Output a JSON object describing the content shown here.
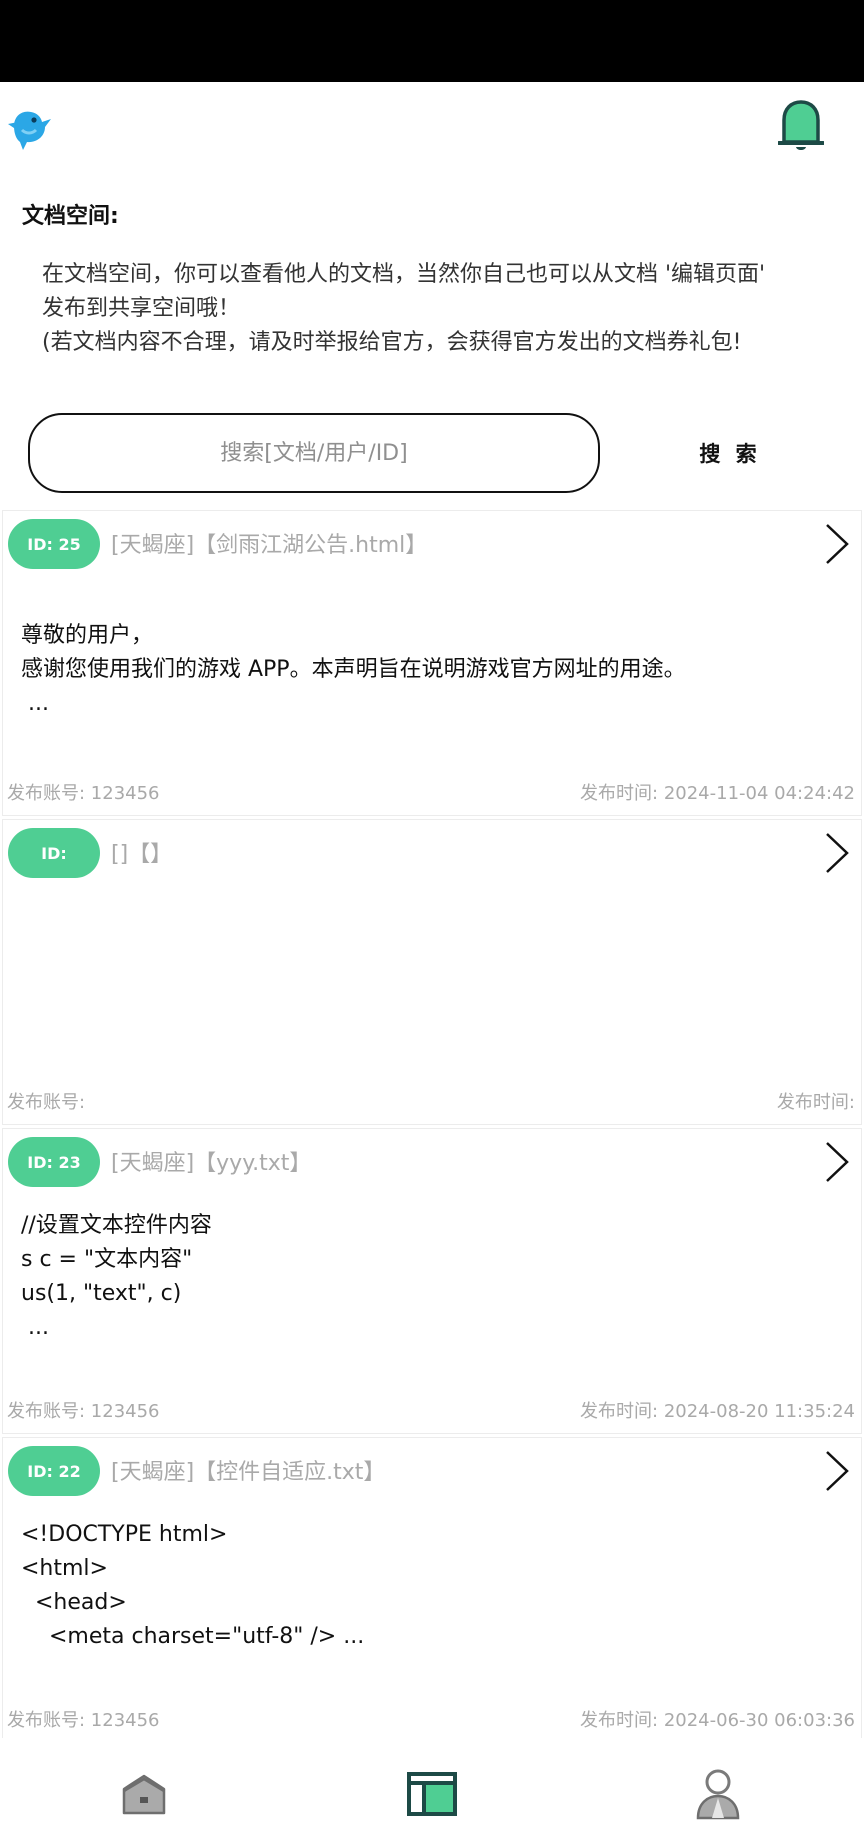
{
  "header": {
    "logo_icon": "bird-icon",
    "notification_icon": "bell-icon",
    "accent_color": "#4fce93"
  },
  "section": {
    "title": "文档空间:",
    "intro_lines": [
      "在文档空间，你可以查看他人的文档，当然你自己也可以从文档 '编辑页面'",
      "发布到共享空间哦！",
      "(若文档内容不合理，请及时举报给官方，会获得官方发出的文档券礼包!"
    ]
  },
  "search": {
    "placeholder": "搜索[文档/用户/ID]",
    "button_label": "搜 索"
  },
  "cards": [
    {
      "id_label": "ID: 25",
      "title": "[天蝎座]【剑雨江湖公告.html】",
      "content_lines": [
        "尊敬的用户，",
        "感谢您使用我们的游戏 APP。本声明旨在说明游戏官方网址的用途。",
        " ..."
      ],
      "account": "发布账号: 123456",
      "time": "发布时间:  2024-11-04 04:24:42"
    },
    {
      "id_label": "ID:",
      "title": "[]【】",
      "content_lines": [],
      "account": "发布账号:",
      "time": "发布时间:"
    },
    {
      "id_label": "ID: 23",
      "title": "[天蝎座]【yyy.txt】",
      "content_lines": [
        "//设置文本控件内容",
        "s c = \"文本内容\"",
        "us(1, \"text\", c)",
        " ..."
      ],
      "account": "发布账号: 123456",
      "time": "发布时间:  2024-08-20 11:35:24"
    },
    {
      "id_label": "ID: 22",
      "title": "[天蝎座]【控件自适应.txt】",
      "content_lines": [
        "<!DOCTYPE html>",
        "<html>",
        "  <head>",
        "    <meta charset=\"utf-8\" /> ..."
      ],
      "account": "发布账号: 123456",
      "time": "发布时间:  2024-06-30 06:03:36"
    }
  ],
  "bottom_nav": {
    "items": [
      {
        "icon": "home-icon"
      },
      {
        "icon": "document-space-icon"
      },
      {
        "icon": "profile-icon"
      }
    ]
  }
}
